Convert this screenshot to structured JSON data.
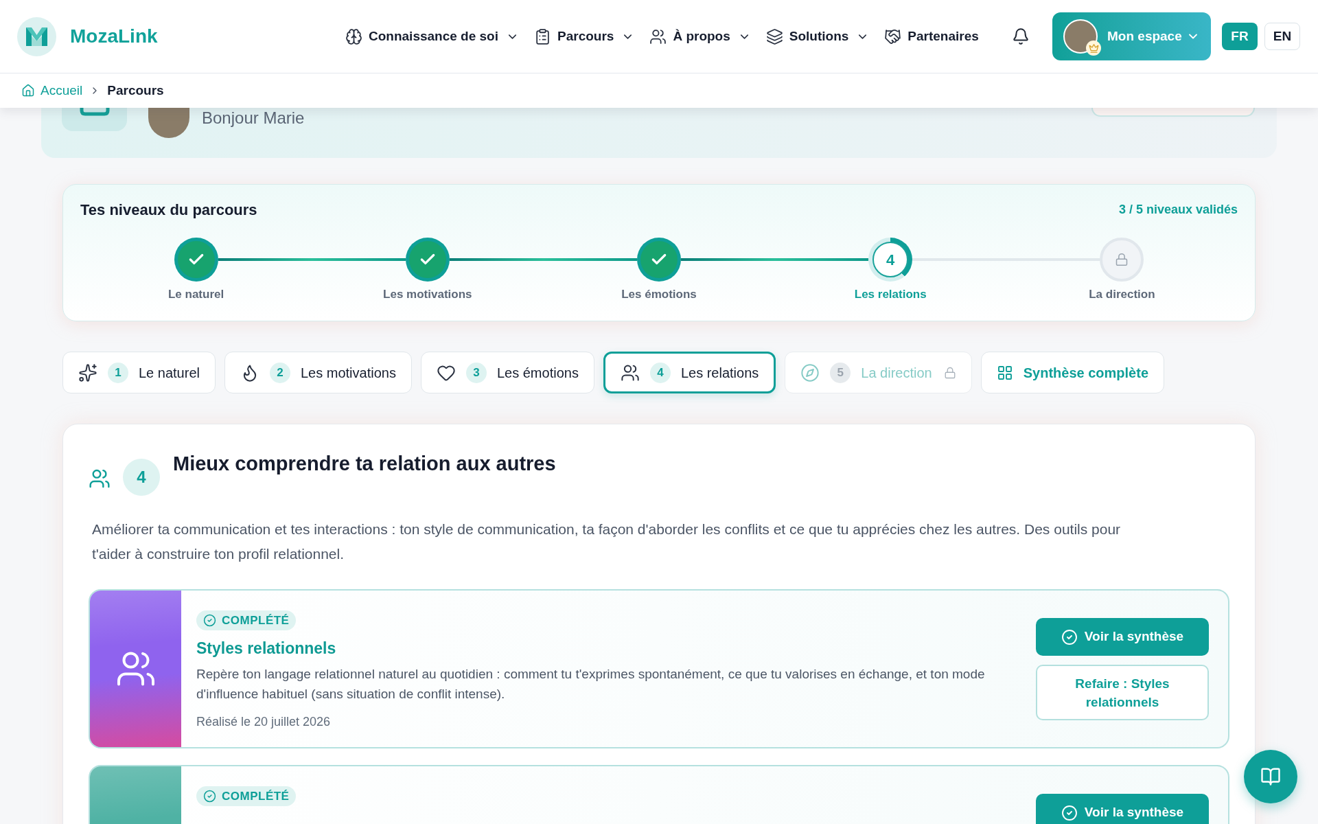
{
  "header": {
    "brand": "MozaLink",
    "nav": [
      {
        "label": "Connaissance de soi",
        "dropdown": true
      },
      {
        "label": "Parcours",
        "dropdown": true
      },
      {
        "label": "À propos",
        "dropdown": true
      },
      {
        "label": "Solutions",
        "dropdown": true
      },
      {
        "label": "Partenaires",
        "dropdown": false
      }
    ],
    "account": {
      "label": "Mon espace"
    },
    "languages": [
      {
        "label": "FR",
        "selected": true
      },
      {
        "label": "EN",
        "selected": false
      }
    ]
  },
  "breadcrumb": [
    {
      "label": "Accueil"
    },
    {
      "label": "Parcours"
    }
  ],
  "welcome": {
    "greeting": "Bonjour Marie"
  },
  "levels": {
    "title": "Tes niveaux du parcours",
    "summary": "3 / 5 niveaux validés",
    "steps": [
      {
        "label": "Le naturel",
        "completed": true,
        "selected": false,
        "locked": false
      },
      {
        "label": "Les motivations",
        "completed": true,
        "selected": false,
        "locked": false
      },
      {
        "label": "Les émotions",
        "completed": true,
        "selected": false,
        "locked": false
      },
      {
        "number": "4",
        "label": "Les relations",
        "completed": false,
        "selected": true,
        "locked": false
      },
      {
        "label": "La direction",
        "completed": false,
        "selected": false,
        "locked": true
      }
    ]
  },
  "tabs": [
    {
      "kind": "level",
      "number": "1",
      "label": "Le naturel",
      "selected": false,
      "disabled": false
    },
    {
      "kind": "level",
      "number": "2",
      "label": "Les motivations",
      "selected": false,
      "disabled": false
    },
    {
      "kind": "level",
      "number": "3",
      "label": "Les émotions",
      "selected": false,
      "disabled": false
    },
    {
      "kind": "level",
      "number": "4",
      "label": "Les relations",
      "selected": true,
      "disabled": false
    },
    {
      "kind": "level",
      "number": "5",
      "label": "La direction",
      "selected": false,
      "disabled": true
    },
    {
      "kind": "summary",
      "label": "Synthèse complète",
      "selected": false,
      "disabled": false
    }
  ],
  "section": {
    "number": "4",
    "title": "Mieux comprendre ta relation aux autres",
    "description": "Améliorer ta communication et tes interactions : ton style de communication, ta façon d'aborder les conflits et ce que tu apprécies chez les autres. Des outils pour t'aider à construire ton profil relationnel.",
    "activities": [
      {
        "color": "#8f63ee",
        "status": "COMPLÉTÉ",
        "title": "Styles relationnels",
        "description": "Repère ton langage relationnel naturel au quotidien : comment tu t'exprimes spontanément, ce que tu valorises en échange, et ton mode d'influence habituel (sans situation de conflit intense).",
        "date": "Réalisé le 20 juillet 2026",
        "actions": [
          {
            "kind": "primary",
            "label": "Voir la synthèse"
          },
          {
            "kind": "secondary",
            "label": "Refaire : Styles relationnels"
          }
        ]
      },
      {
        "color": "#4fb2a4",
        "status": "COMPLÉTÉ",
        "actions": [
          {
            "kind": "primary",
            "label": "Voir la synthèse"
          }
        ]
      }
    ]
  }
}
